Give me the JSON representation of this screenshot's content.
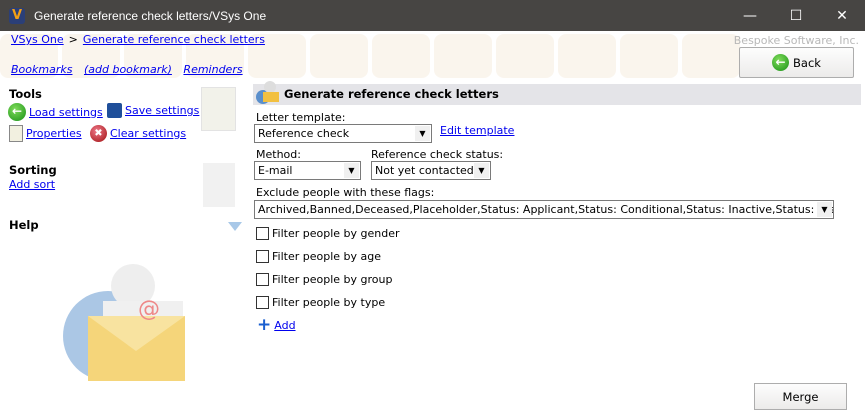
{
  "window": {
    "title": "Generate reference check letters/VSys One"
  },
  "breadcrumb": {
    "root": "VSys One",
    "separator": ">",
    "current": "Generate reference check letters"
  },
  "company": "Bespoke Software, Inc.",
  "links": {
    "bookmarks": "Bookmarks",
    "add_bookmark": "(add bookmark)",
    "reminders": "Reminders"
  },
  "back_label": "Back",
  "tools": {
    "heading": "Tools",
    "load": "Load settings",
    "save": "Save settings",
    "properties": "Properties",
    "clear": "Clear settings"
  },
  "sorting": {
    "heading": "Sorting",
    "add_sort": "Add sort"
  },
  "help": {
    "heading": "Help"
  },
  "panel": {
    "title": "Generate reference check letters"
  },
  "form": {
    "letter_template_label": "Letter template:",
    "letter_template_value": "Reference check",
    "edit_template": "Edit template",
    "method_label": "Method:",
    "method_value": "E-mail",
    "status_label": "Reference check status:",
    "status_value": "Not yet contacted",
    "exclude_label": "Exclude people with these flags:",
    "exclude_value": "Archived,Banned,Deceased,Placeholder,Status: Applicant,Status: Conditional,Status: Inactive,Status: Leave of abs",
    "filters": [
      {
        "label": "Filter people by gender",
        "checked": false
      },
      {
        "label": "Filter people by age",
        "checked": false
      },
      {
        "label": "Filter people by group",
        "checked": false
      },
      {
        "label": "Filter people by type",
        "checked": false
      }
    ],
    "add_label": "Add"
  },
  "merge_label": "Merge"
}
